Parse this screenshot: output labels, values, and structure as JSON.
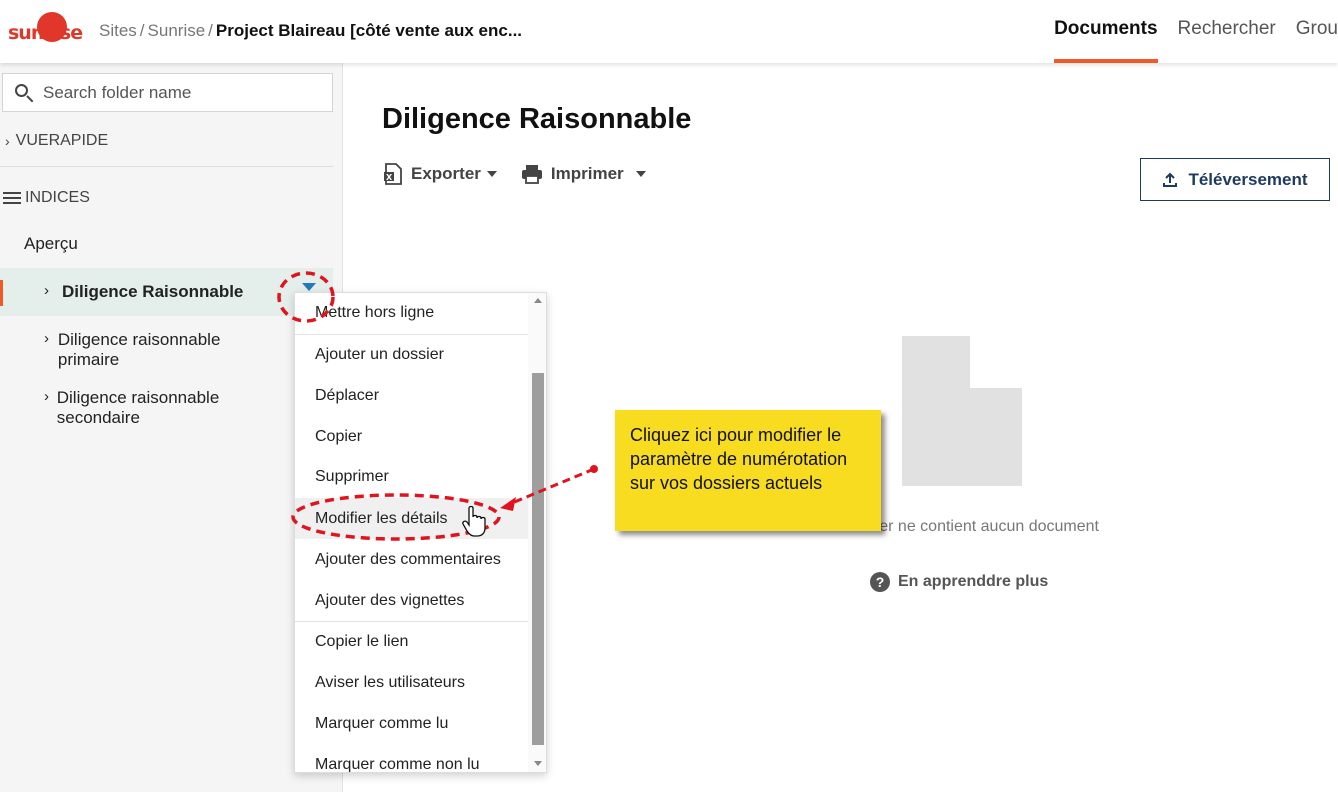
{
  "header": {
    "logo_text": "sunrise",
    "breadcrumb": [
      "Sites",
      "Sunrise"
    ],
    "current_project": "Project Blaireau [côté vente aux enc...",
    "nav": [
      {
        "label": "Documents",
        "active": true
      },
      {
        "label": "Rechercher",
        "active": false
      },
      {
        "label": "Grou",
        "active": false
      }
    ],
    "accent_color": "#f05a28"
  },
  "sidebar": {
    "search_placeholder": "Search folder name",
    "quick_view_label": "VUERAPIDE",
    "indices_label": "INDICES",
    "overview_label": "Aperçu",
    "folders": [
      {
        "label": "Diligence Raisonnable",
        "selected": true
      },
      {
        "label": "Diligence raisonnable primaire",
        "selected": false
      },
      {
        "label": "Diligence raisonnable secondaire",
        "selected": false
      }
    ]
  },
  "main": {
    "title": "Diligence Raisonnable",
    "export_label": "Exporter",
    "print_label": "Imprimer",
    "upload_label": "Téléversement",
    "empty_message": "Ce dossier ne contient aucun document",
    "learn_more_label": "En apprenddre plus"
  },
  "context_menu": {
    "items": [
      "Mettre hors ligne",
      "Ajouter un dossier",
      "Déplacer",
      "Copier",
      "Supprimer",
      "Modifier les détails",
      "Ajouter des commentaires",
      "Ajouter des vignettes",
      "Copier le lien",
      "Aviser les utilisateurs",
      "Marquer comme lu",
      "Marquer comme non lu"
    ],
    "hovered_item": "Modifier les détails"
  },
  "callout": {
    "text": "Cliquez ici pour modifier le paramètre de numérotation sur vos dossiers actuels",
    "background": "#f7dc1f",
    "annotation_color": "#e0141e"
  }
}
